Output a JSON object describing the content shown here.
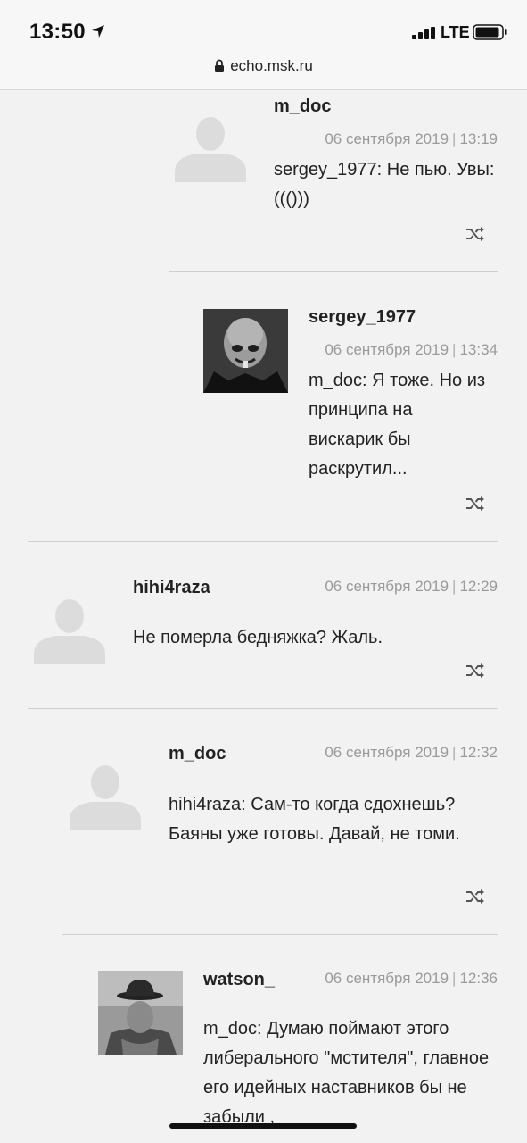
{
  "status": {
    "time": "13:50",
    "network": "LTE"
  },
  "browser": {
    "url": "echo.msk.ru"
  },
  "comments": [
    {
      "user": "m_doc",
      "date": "06 сентября 2019",
      "time": "13:19",
      "text": "sergey_1977: Не пью. Увы:((()))",
      "avatar": "default-avatar-icon"
    },
    {
      "user": "sergey_1977",
      "date": "06 сентября 2019",
      "time": "13:34",
      "text": "m_doc: Я тоже. Но из принципа на вискарик бы раскрутил...",
      "avatar": "bald-cartoon-avatar"
    },
    {
      "user": "hihi4raza",
      "date": "06 сентября 2019",
      "time": "12:29",
      "text": "Не померла бедняжка? Жаль.",
      "avatar": "default-avatar-icon"
    },
    {
      "user": "m_doc",
      "date": "06 сентября 2019",
      "time": "12:32",
      "text": "hihi4raza: Сам-то когда сдохнешь? Баяны уже готовы. Давай, не томи.",
      "avatar": "default-avatar-icon"
    },
    {
      "user": "watson_",
      "date": "06 сентября 2019",
      "time": "12:36",
      "text": "m_doc: Думаю поймают этого либерального \"мстителя\", главное его идейных наставников бы не забыли ,",
      "avatar": "man-in-hat-avatar"
    }
  ]
}
